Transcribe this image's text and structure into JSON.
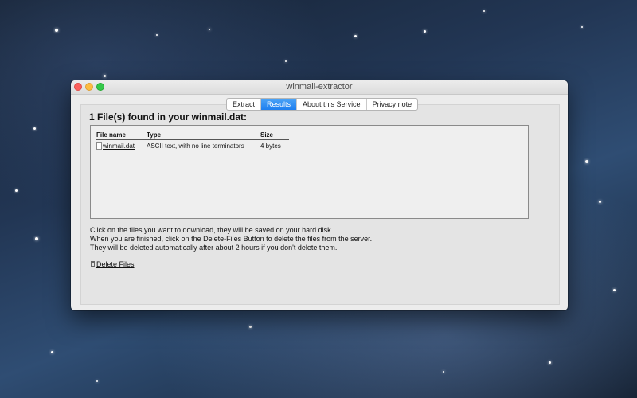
{
  "window": {
    "title": "winmail-extractor"
  },
  "tabs": [
    {
      "label": "Extract",
      "active": false
    },
    {
      "label": "Results",
      "active": true
    },
    {
      "label": "About this Service",
      "active": false
    },
    {
      "label": "Privacy note",
      "active": false
    }
  ],
  "results": {
    "heading": "1 File(s) found in your winmail.dat:",
    "columns": [
      "File name",
      "Type",
      "Size"
    ],
    "rows": [
      {
        "name": "winmail.dat",
        "type": "ASCII text, with no line terminators",
        "size": "4 bytes"
      }
    ],
    "instructions": [
      "Click on the files you want to download, they will be saved on your hard disk.",
      "When you are finished, click on the Delete-Files Button to delete the files from the server.",
      "They will be deleted automatically after about 2 hours if you don't delete them."
    ],
    "delete_label": "Delete Files"
  },
  "icons": {
    "file": "document-icon",
    "delete": "trash-icon"
  },
  "colors": {
    "active_tab": "#1e7ff0",
    "close": "#fc605c",
    "minimize": "#fdbc40",
    "maximize": "#34c84a"
  }
}
